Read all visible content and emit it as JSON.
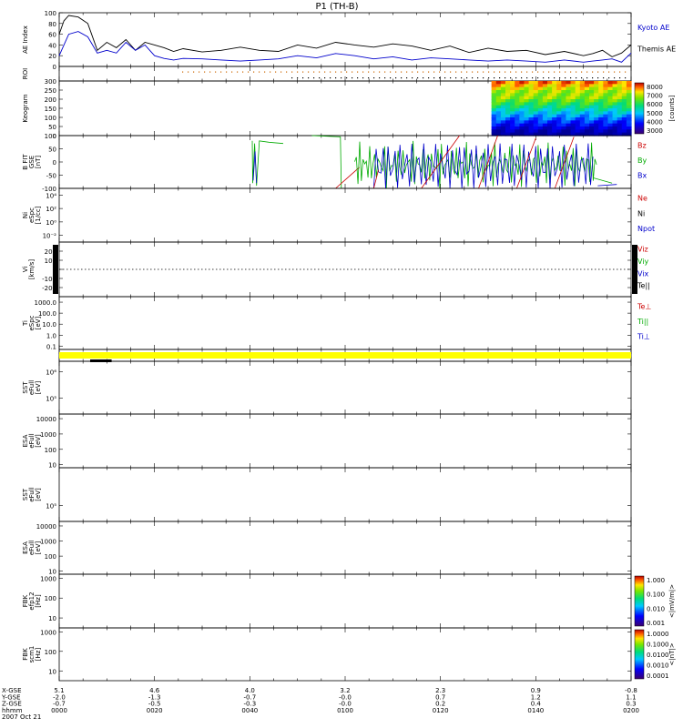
{
  "title": "P1 (TH-B)",
  "time_range": {
    "start": 0,
    "end": 120
  },
  "bottom_axis": {
    "row_labels": [
      "X-GSE",
      "Y-GSE",
      "Z-GSE",
      "hhmm",
      "2007 Oct 21"
    ],
    "columns": [
      {
        "t": 0,
        "vals": [
          "5.1",
          "-2.0",
          "-0.7",
          "0000"
        ]
      },
      {
        "t": 20,
        "vals": [
          "4.6",
          "-1.3",
          "-0.5",
          "0020"
        ]
      },
      {
        "t": 40,
        "vals": [
          "4.0",
          "-0.7",
          "-0.3",
          "0040"
        ]
      },
      {
        "t": 60,
        "vals": [
          "3.2",
          "-0.0",
          "-0.0",
          "0100"
        ]
      },
      {
        "t": 80,
        "vals": [
          "2.3",
          "0.7",
          "0.2",
          "0120"
        ]
      },
      {
        "t": 100,
        "vals": [
          "0.9",
          "1.2",
          "0.4",
          "0140"
        ]
      },
      {
        "t": 120,
        "vals": [
          "-0.8",
          "1.1",
          "0.3",
          "0200"
        ]
      }
    ]
  },
  "colorbars": [
    {
      "panel": "kmap",
      "ticks": [
        "8000",
        "7000",
        "6000",
        "5000",
        "4000",
        "3000"
      ],
      "label": "[counts]"
    },
    {
      "panel": "fbk1",
      "ticks": [
        "1.000",
        "0.100",
        "0.010",
        "0.001"
      ],
      "label": "<|mV/m|>"
    },
    {
      "panel": "fbk2",
      "ticks": [
        "1.0000",
        "0.1000",
        "0.0100",
        "0.0010",
        "0.0001"
      ],
      "label": "<|nT|>"
    }
  ],
  "panels": [
    {
      "key": "ae",
      "label": [
        "AE Index"
      ],
      "ticks": [
        {
          "v": 100,
          "t": "100"
        },
        {
          "v": 80,
          "t": "80"
        },
        {
          "v": 60,
          "t": "60"
        },
        {
          "v": 40,
          "t": "40"
        },
        {
          "v": 20,
          "t": "20"
        },
        {
          "v": 0,
          "t": "0"
        }
      ],
      "range": [
        0,
        100
      ],
      "legend": [
        {
          "t": "Kyoto AE",
          "c": "#0000cc"
        },
        {
          "t": "Themis AE",
          "c": "#000000"
        }
      ]
    },
    {
      "key": "roi",
      "label": [
        "ROI"
      ],
      "ticks": [],
      "legend": []
    },
    {
      "key": "kmap",
      "label": [
        "Keogram"
      ],
      "ticks": [
        {
          "v": 300,
          "t": "300"
        },
        {
          "v": 250,
          "t": "250"
        },
        {
          "v": 200,
          "t": "200"
        },
        {
          "v": 150,
          "t": "150"
        },
        {
          "v": 100,
          "t": "100"
        },
        {
          "v": 50,
          "t": "50"
        },
        {
          "v": 0,
          "t": "0"
        }
      ],
      "range": [
        0,
        300
      ],
      "legend": []
    },
    {
      "key": "bfit",
      "label": [
        "B FIT",
        "GSE",
        "[nT]"
      ],
      "ticks": [
        {
          "v": 100,
          "t": "100"
        },
        {
          "v": 50,
          "t": "50"
        },
        {
          "v": 0,
          "t": "0"
        },
        {
          "v": -50,
          "t": "-50"
        },
        {
          "v": -100,
          "t": "-100"
        }
      ],
      "range": [
        -100,
        100
      ],
      "legend": [
        {
          "t": "Bz",
          "c": "#cc0000"
        },
        {
          "t": "By",
          "c": "#00aa00"
        },
        {
          "t": "Bx",
          "c": "#0000cc"
        }
      ]
    },
    {
      "key": "ni",
      "label": [
        "Ni",
        "eSpc",
        "[1/cc]"
      ],
      "ticks": [
        {
          "v": 4,
          "t": "10⁴"
        },
        {
          "v": 2,
          "t": "10²"
        },
        {
          "v": 0,
          "t": "10⁰"
        },
        {
          "v": -2,
          "t": "10⁻²"
        }
      ],
      "range": [
        -3,
        5
      ],
      "legend": [
        {
          "t": "Ne",
          "c": "#cc0000"
        },
        {
          "t": "Ni",
          "c": "#000000"
        },
        {
          "t": "Npot",
          "c": "#0000cc"
        }
      ]
    },
    {
      "key": "vi",
      "label": [
        "Vi",
        "[km/s]"
      ],
      "ticks": [
        {
          "v": 200,
          "t": "200"
        },
        {
          "v": 100,
          "t": "100"
        },
        {
          "v": 0,
          "t": "0"
        },
        {
          "v": -100,
          "t": "-100"
        },
        {
          "v": -200,
          "t": "-200"
        }
      ],
      "range": [
        -300,
        300
      ],
      "legend": [
        {
          "t": "Viz",
          "c": "#cc0000"
        },
        {
          "t": "Viy",
          "c": "#00aa00"
        },
        {
          "t": "Vix",
          "c": "#0000cc"
        },
        {
          "t": "Te||",
          "c": "#000000"
        }
      ]
    },
    {
      "key": "ti",
      "label": [
        "Ti",
        "eSpc",
        "[eV]"
      ],
      "ticks": [
        {
          "v": 3,
          "t": "1000.0"
        },
        {
          "v": 2,
          "t": "100.0"
        },
        {
          "v": 1,
          "t": "10.0"
        },
        {
          "v": 0,
          "t": "1.0"
        },
        {
          "v": -1,
          "t": "0.1"
        }
      ],
      "range": [
        -1.3,
        3.5
      ],
      "legend": [
        {
          "t": "Te⊥",
          "c": "#cc0000"
        },
        {
          "t": "Ti||",
          "c": "#00aa00"
        },
        {
          "t": "Ti⊥",
          "c": "#0000cc"
        }
      ]
    },
    {
      "key": "mode",
      "label": [],
      "ticks": [],
      "legend": []
    },
    {
      "key": "sst1",
      "label": [
        "SST",
        "eFull",
        "[eV]"
      ],
      "ticks": [
        {
          "v": 1,
          "t": "10⁶"
        },
        {
          "v": 0,
          "t": "10⁵"
        }
      ],
      "range": [
        -0.6,
        1.4
      ],
      "legend": []
    },
    {
      "key": "esa1",
      "label": [
        "ESA",
        "eFull",
        "[eV]"
      ],
      "ticks": [
        {
          "v": 4,
          "t": "10000"
        },
        {
          "v": 3,
          "t": "1000"
        },
        {
          "v": 2,
          "t": "100"
        },
        {
          "v": 1,
          "t": "10"
        }
      ],
      "range": [
        0.8,
        4.3
      ],
      "legend": []
    },
    {
      "key": "sst2",
      "label": [
        "SST",
        "eFull",
        "[eV]"
      ],
      "ticks": [
        {
          "v": 0,
          "t": "10⁵"
        }
      ],
      "range": [
        -0.6,
        1.4
      ],
      "legend": []
    },
    {
      "key": "esa2",
      "label": [
        "ESA",
        "eFull",
        "[eV]"
      ],
      "ticks": [
        {
          "v": 4,
          "t": "10000"
        },
        {
          "v": 3,
          "t": "1000"
        },
        {
          "v": 2,
          "t": "100"
        },
        {
          "v": 1,
          "t": "10"
        }
      ],
      "range": [
        0.8,
        4.3
      ],
      "legend": []
    },
    {
      "key": "fbk1",
      "label": [
        "FBK",
        "efp12",
        "[Hz]"
      ],
      "ticks": [
        {
          "v": 3,
          "t": "1000"
        },
        {
          "v": 2,
          "t": "100"
        },
        {
          "v": 1,
          "t": "10"
        }
      ],
      "range": [
        0.5,
        3.2
      ],
      "legend": []
    },
    {
      "key": "fbk2",
      "label": [
        "FBK",
        "scm1",
        "[Hz]"
      ],
      "ticks": [
        {
          "v": 3,
          "t": "1000"
        },
        {
          "v": 2,
          "t": "100"
        },
        {
          "v": 1,
          "t": "10"
        }
      ],
      "range": [
        0.5,
        3.2
      ],
      "legend": []
    }
  ],
  "chart_data": {
    "type": "line",
    "title": "P1 (TH-B)",
    "xlabel": "hhmm",
    "x_range": [
      0,
      120
    ],
    "ae_series": [
      {
        "name": "Themis AE",
        "color": "#000000",
        "x": [
          0,
          1,
          2,
          4,
          6,
          8,
          10,
          12,
          14,
          16,
          18,
          20,
          22,
          24,
          26,
          30,
          34,
          38,
          42,
          46,
          50,
          54,
          58,
          62,
          66,
          70,
          74,
          78,
          82,
          86,
          90,
          94,
          98,
          102,
          106,
          110,
          112,
          114,
          116,
          118,
          120
        ],
        "y": [
          60,
          85,
          95,
          92,
          80,
          30,
          45,
          35,
          50,
          30,
          45,
          40,
          35,
          28,
          33,
          27,
          30,
          36,
          30,
          28,
          40,
          34,
          45,
          40,
          36,
          42,
          38,
          30,
          38,
          26,
          34,
          28,
          30,
          22,
          28,
          20,
          24,
          30,
          18,
          25,
          40
        ]
      },
      {
        "name": "Kyoto AE",
        "color": "#0000cc",
        "x": [
          0,
          1,
          2,
          4,
          6,
          8,
          10,
          12,
          14,
          16,
          18,
          20,
          22,
          24,
          26,
          30,
          34,
          38,
          42,
          46,
          50,
          54,
          58,
          62,
          66,
          70,
          74,
          78,
          82,
          86,
          90,
          94,
          98,
          102,
          106,
          110,
          112,
          114,
          116,
          118,
          120
        ],
        "y": [
          20,
          40,
          60,
          65,
          55,
          25,
          30,
          25,
          45,
          30,
          40,
          20,
          15,
          12,
          15,
          14,
          12,
          10,
          12,
          14,
          20,
          16,
          24,
          20,
          14,
          18,
          12,
          16,
          14,
          12,
          10,
          12,
          10,
          8,
          12,
          8,
          10,
          12,
          14,
          8,
          25
        ]
      }
    ],
    "bfit_series": [
      {
        "name": "Bz",
        "color": "#cc0000"
      },
      {
        "name": "By",
        "color": "#00aa00"
      },
      {
        "name": "Bx",
        "color": "#0000cc"
      }
    ],
    "keogram": {
      "x_start": 90.7,
      "x_end": 120,
      "y_range": [
        0,
        300
      ],
      "value_range": [
        3000,
        8000
      ]
    },
    "mode_bar": {
      "color": "#ffff00",
      "marker_x": [
        6.5,
        11
      ]
    }
  }
}
